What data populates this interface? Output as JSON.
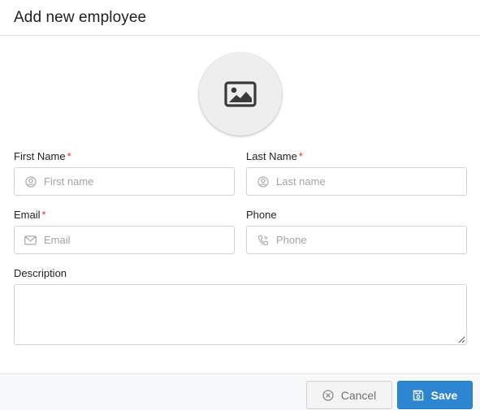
{
  "dialog": {
    "title": "Add new employee"
  },
  "avatar": {
    "icon": "image-icon"
  },
  "form": {
    "first_name": {
      "label": "First Name",
      "required_mark": "*",
      "placeholder": "First name",
      "value": "",
      "icon": "user-circle-icon"
    },
    "last_name": {
      "label": "Last Name",
      "required_mark": "*",
      "placeholder": "Last name",
      "value": "",
      "icon": "user-circle-icon"
    },
    "email": {
      "label": "Email",
      "required_mark": "*",
      "placeholder": "Email",
      "value": "",
      "icon": "envelope-icon"
    },
    "phone": {
      "label": "Phone",
      "placeholder": "Phone",
      "value": "",
      "icon": "phone-icon"
    },
    "description": {
      "label": "Description",
      "value": ""
    }
  },
  "footer": {
    "cancel_label": "Cancel",
    "cancel_icon": "cancel-circle-icon",
    "save_label": "Save",
    "save_icon": "floppy-disk-icon"
  },
  "colors": {
    "primary": "#2d86d1",
    "required": "#d9302a",
    "border": "#d3d3d3",
    "placeholder": "#a3a3a3",
    "footer_bg": "#f7f8fa"
  }
}
